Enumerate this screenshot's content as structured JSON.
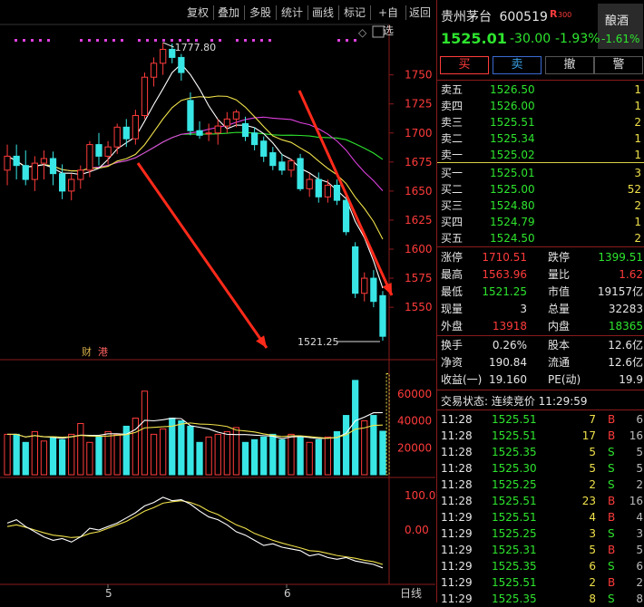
{
  "toolbar": {
    "items": [
      "复权",
      "叠加",
      "多股",
      "统计",
      "画线",
      "标记",
      "+自选",
      "返回"
    ]
  },
  "chart": {
    "price_axis": [
      "1750",
      "1725",
      "1700",
      "1675",
      "1650",
      "1625",
      "1600",
      "1575",
      "1550"
    ],
    "volume_axis": [
      "60000",
      "40000",
      "20000"
    ],
    "macd_axis": [
      "100.0",
      "0.00"
    ],
    "high_label": "1777.80",
    "low_label": "1521.25",
    "date_labels": [
      "5",
      "6"
    ],
    "period_label": "日线",
    "tag_cai": "财",
    "tag_gang": "港",
    "colors": {
      "up": "#ff3b3b",
      "down": "#39e6e6",
      "ma5": "#ffffff",
      "ma10": "#f0e14a",
      "ma20": "#e040e0",
      "ma30": "#2ee52e",
      "grid": "#8a1b1b",
      "arrow": "#ff2a1a"
    }
  },
  "chart_data": {
    "type": "candlestick",
    "price_ylim": [
      1520,
      1780
    ],
    "candles": [
      {
        "o": 1668,
        "h": 1690,
        "l": 1655,
        "c": 1680
      },
      {
        "o": 1680,
        "h": 1690,
        "l": 1660,
        "c": 1672
      },
      {
        "o": 1672,
        "h": 1685,
        "l": 1655,
        "c": 1660
      },
      {
        "o": 1660,
        "h": 1680,
        "l": 1650,
        "c": 1674
      },
      {
        "o": 1674,
        "h": 1685,
        "l": 1660,
        "c": 1678
      },
      {
        "o": 1678,
        "h": 1684,
        "l": 1655,
        "c": 1665
      },
      {
        "o": 1665,
        "h": 1673,
        "l": 1643,
        "c": 1650
      },
      {
        "o": 1650,
        "h": 1665,
        "l": 1642,
        "c": 1660
      },
      {
        "o": 1660,
        "h": 1672,
        "l": 1652,
        "c": 1668
      },
      {
        "o": 1668,
        "h": 1693,
        "l": 1662,
        "c": 1690
      },
      {
        "o": 1690,
        "h": 1700,
        "l": 1672,
        "c": 1680
      },
      {
        "o": 1680,
        "h": 1693,
        "l": 1673,
        "c": 1688
      },
      {
        "o": 1688,
        "h": 1708,
        "l": 1682,
        "c": 1705
      },
      {
        "o": 1705,
        "h": 1712,
        "l": 1688,
        "c": 1695
      },
      {
        "o": 1695,
        "h": 1720,
        "l": 1690,
        "c": 1715
      },
      {
        "o": 1715,
        "h": 1752,
        "l": 1712,
        "c": 1748
      },
      {
        "o": 1748,
        "h": 1765,
        "l": 1740,
        "c": 1760
      },
      {
        "o": 1760,
        "h": 1777.8,
        "l": 1750,
        "c": 1772
      },
      {
        "o": 1772,
        "h": 1777,
        "l": 1760,
        "c": 1765
      },
      {
        "o": 1765,
        "h": 1768,
        "l": 1745,
        "c": 1752
      },
      {
        "o": 1728,
        "h": 1735,
        "l": 1698,
        "c": 1702
      },
      {
        "o": 1702,
        "h": 1710,
        "l": 1695,
        "c": 1698
      },
      {
        "o": 1700,
        "h": 1708,
        "l": 1693,
        "c": 1700
      },
      {
        "o": 1700,
        "h": 1712,
        "l": 1690,
        "c": 1706
      },
      {
        "o": 1706,
        "h": 1718,
        "l": 1700,
        "c": 1712
      },
      {
        "o": 1712,
        "h": 1720,
        "l": 1705,
        "c": 1718
      },
      {
        "o": 1708,
        "h": 1714,
        "l": 1693,
        "c": 1697
      },
      {
        "o": 1700,
        "h": 1705,
        "l": 1685,
        "c": 1690
      },
      {
        "o": 1693,
        "h": 1697,
        "l": 1675,
        "c": 1680
      },
      {
        "o": 1683,
        "h": 1688,
        "l": 1668,
        "c": 1672
      },
      {
        "o": 1675,
        "h": 1682,
        "l": 1664,
        "c": 1668
      },
      {
        "o": 1668,
        "h": 1678,
        "l": 1662,
        "c": 1676
      },
      {
        "o": 1678,
        "h": 1682,
        "l": 1650,
        "c": 1652
      },
      {
        "o": 1652,
        "h": 1665,
        "l": 1645,
        "c": 1660
      },
      {
        "o": 1660,
        "h": 1666,
        "l": 1640,
        "c": 1645
      },
      {
        "o": 1645,
        "h": 1660,
        "l": 1640,
        "c": 1655
      },
      {
        "o": 1655,
        "h": 1660,
        "l": 1638,
        "c": 1642
      },
      {
        "o": 1642,
        "h": 1648,
        "l": 1612,
        "c": 1615
      },
      {
        "o": 1602,
        "h": 1606,
        "l": 1558,
        "c": 1562
      },
      {
        "o": 1562,
        "h": 1580,
        "l": 1555,
        "c": 1575
      },
      {
        "o": 1575,
        "h": 1582,
        "l": 1550,
        "c": 1555
      },
      {
        "o": 1560,
        "h": 1563.96,
        "l": 1521.25,
        "c": 1525.01
      }
    ],
    "volume_ylim": [
      0,
      80000
    ],
    "volumes": [
      30000,
      30000,
      24000,
      32000,
      25000,
      28000,
      26000,
      30000,
      38000,
      24000,
      28000,
      32000,
      30000,
      36000,
      42000,
      62000,
      30000,
      34000,
      42000,
      40000,
      36000,
      24000,
      28000,
      30000,
      32000,
      35000,
      24000,
      26000,
      28000,
      30000,
      26000,
      30000,
      28000,
      24000,
      26000,
      28000,
      32000,
      44000,
      70000,
      40000,
      44000,
      32283
    ],
    "macd_ylim": [
      -120,
      150
    ],
    "macd_line": [
      20,
      30,
      10,
      -5,
      -20,
      -30,
      -25,
      -35,
      -20,
      5,
      0,
      10,
      20,
      35,
      50,
      70,
      80,
      95,
      85,
      88,
      75,
      55,
      38,
      30,
      15,
      -5,
      -15,
      -30,
      -45,
      -40,
      -50,
      -55,
      -60,
      -75,
      -70,
      -80,
      -85,
      -80,
      -90,
      -95,
      -100,
      -110
    ],
    "signal_line": [
      10,
      15,
      8,
      0,
      -8,
      -15,
      -18,
      -22,
      -20,
      -10,
      -5,
      5,
      15,
      25,
      40,
      55,
      65,
      78,
      82,
      85,
      80,
      70,
      55,
      45,
      30,
      15,
      5,
      -10,
      -20,
      -30,
      -38,
      -45,
      -52,
      -60,
      -62,
      -68,
      -74,
      -78,
      -82,
      -88,
      -92,
      -100
    ]
  },
  "panel": {
    "stock_name": "贵州茅台",
    "stock_code": "600519",
    "r_badge": "R",
    "r_num": "300",
    "sector": "酿酒",
    "sector_change": "-1.61%",
    "price": "1525.01",
    "change": "-30.00",
    "change_pct": "-1.93%",
    "buttons": [
      "买",
      "卖",
      "撤",
      "警"
    ],
    "asks": [
      {
        "label": "卖五",
        "price": "1526.50",
        "vol": "1"
      },
      {
        "label": "卖四",
        "price": "1526.00",
        "vol": "1"
      },
      {
        "label": "卖三",
        "price": "1525.51",
        "vol": "2"
      },
      {
        "label": "卖二",
        "price": "1525.34",
        "vol": "1"
      },
      {
        "label": "卖一",
        "price": "1525.02",
        "vol": "1"
      }
    ],
    "bids": [
      {
        "label": "买一",
        "price": "1525.01",
        "vol": "3"
      },
      {
        "label": "买二",
        "price": "1525.00",
        "vol": "52"
      },
      {
        "label": "买三",
        "price": "1524.80",
        "vol": "2"
      },
      {
        "label": "买四",
        "price": "1524.79",
        "vol": "1"
      },
      {
        "label": "买五",
        "price": "1524.50",
        "vol": "2"
      }
    ],
    "stats": [
      {
        "l1": "涨停",
        "v1": "1710.51",
        "c1": "red",
        "l2": "跌停",
        "v2": "1399.51",
        "c2": "green"
      },
      {
        "l1": "最高",
        "v1": "1563.96",
        "c1": "red",
        "l2": "量比",
        "v2": "1.62",
        "c2": "red"
      },
      {
        "l1": "最低",
        "v1": "1521.25",
        "c1": "green",
        "l2": "市值",
        "v2": "19157亿",
        "c2": "white"
      },
      {
        "l1": "现量",
        "v1": "3",
        "c1": "white",
        "l2": "总量",
        "v2": "32283",
        "c2": "white"
      },
      {
        "l1": "外盘",
        "v1": "13918",
        "c1": "red",
        "l2": "内盘",
        "v2": "18365",
        "c2": "green"
      }
    ],
    "fin": [
      {
        "l1": "换手",
        "v1": "0.26%",
        "l2": "股本",
        "v2": "12.6亿"
      },
      {
        "l1": "净资",
        "v1": "190.84",
        "l2": "流通",
        "v2": "12.6亿"
      },
      {
        "l1": "收益(一)",
        "v1": "19.160",
        "l2": "PE(动)",
        "v2": "19.9"
      }
    ],
    "trade_status": "交易状态: 连续竞价 11:29:59",
    "ticks": [
      {
        "t": "11:28",
        "p": "1525.51",
        "v": "7",
        "s": "B",
        "n": "6"
      },
      {
        "t": "11:28",
        "p": "1525.51",
        "v": "17",
        "s": "B",
        "n": "16"
      },
      {
        "t": "11:28",
        "p": "1525.35",
        "v": "5",
        "s": "S",
        "n": "5"
      },
      {
        "t": "11:28",
        "p": "1525.30",
        "v": "5",
        "s": "S",
        "n": "5"
      },
      {
        "t": "11:28",
        "p": "1525.25",
        "v": "2",
        "s": "S",
        "n": "2"
      },
      {
        "t": "11:28",
        "p": "1525.51",
        "v": "23",
        "s": "B",
        "n": "16"
      },
      {
        "t": "11:29",
        "p": "1525.51",
        "v": "4",
        "s": "B",
        "n": "4"
      },
      {
        "t": "11:29",
        "p": "1525.25",
        "v": "3",
        "s": "S",
        "n": "3"
      },
      {
        "t": "11:29",
        "p": "1525.31",
        "v": "5",
        "s": "B",
        "n": "5"
      },
      {
        "t": "11:29",
        "p": "1525.35",
        "v": "6",
        "s": "S",
        "n": "6"
      },
      {
        "t": "11:29",
        "p": "1525.51",
        "v": "2",
        "s": "B",
        "n": "2"
      },
      {
        "t": "11:29",
        "p": "1525.35",
        "v": "8",
        "s": "S",
        "n": "8"
      }
    ]
  }
}
